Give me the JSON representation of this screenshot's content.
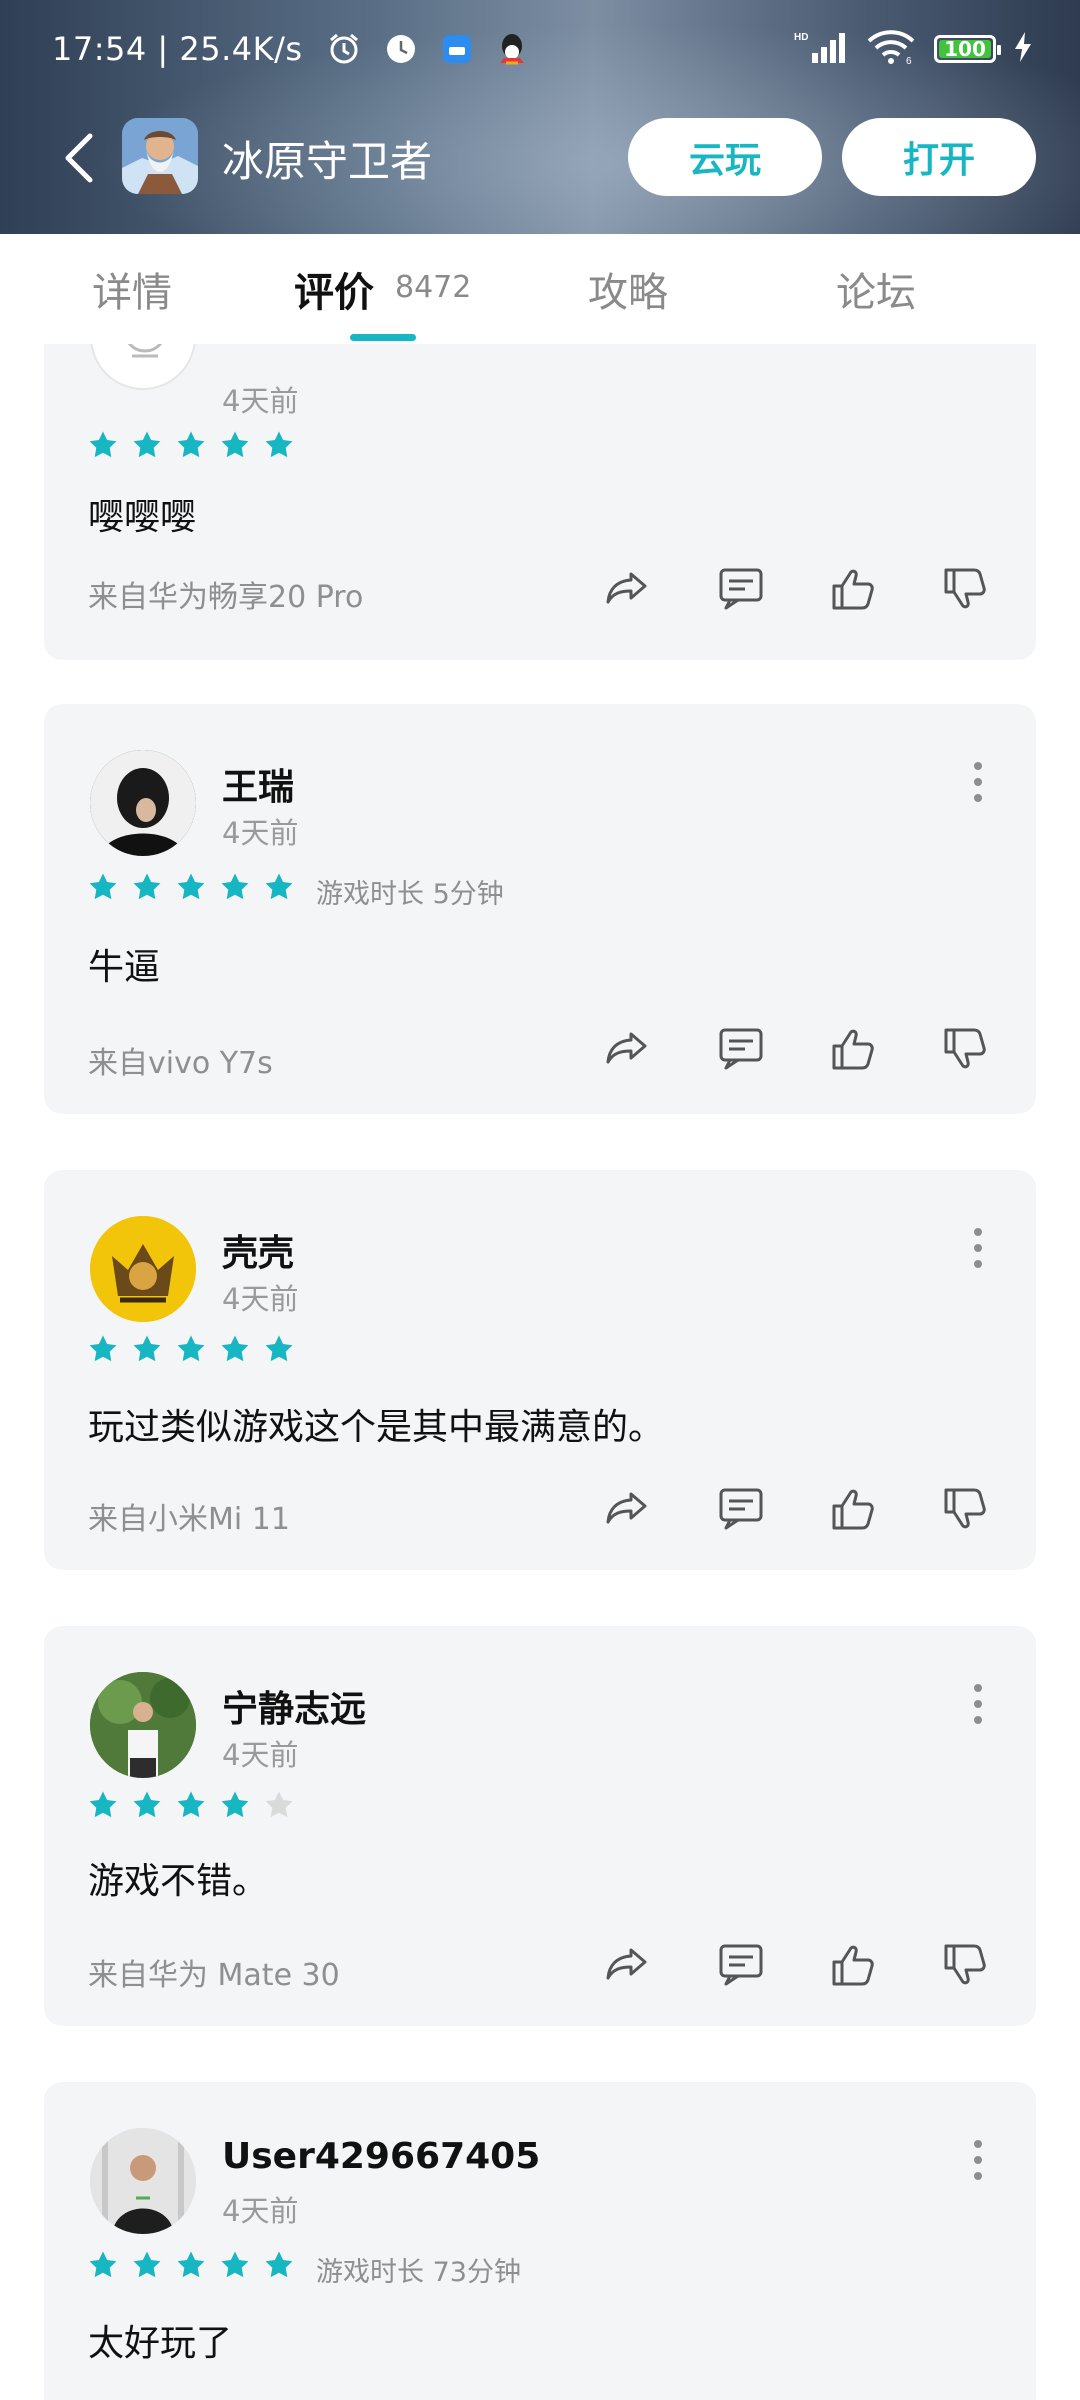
{
  "status_bar": {
    "time_speed": "17:54 | 25.4K/s",
    "battery": "100",
    "signal_label": "HD"
  },
  "header": {
    "title": "冰原守卫者",
    "cloud_play_label": "云玩",
    "open_label": "打开"
  },
  "tabs": [
    {
      "label": "详情"
    },
    {
      "label": "评价",
      "count": "8472"
    },
    {
      "label": "攻略"
    },
    {
      "label": "论坛"
    }
  ],
  "accent_color": "#16b6c2",
  "reviews": [
    {
      "user": "",
      "time": "4天前",
      "stars": 5,
      "playtime": "",
      "text": "嘤嘤嘤",
      "device": "来自华为畅享20 Pro"
    },
    {
      "user": "王瑞",
      "time": "4天前",
      "stars": 5,
      "playtime": "游戏时长 5分钟",
      "text": "牛逼",
      "device": "来自vivo Y7s"
    },
    {
      "user": "壳壳",
      "time": "4天前",
      "stars": 5,
      "playtime": "",
      "text": "玩过类似游戏这个是其中最满意的。",
      "device": "来自小米Mi 11"
    },
    {
      "user": "宁静志远",
      "time": "4天前",
      "stars": 4,
      "playtime": "",
      "text": "游戏不错。",
      "device": "来自华为 Mate 30"
    },
    {
      "user": "User429667405",
      "time": "4天前",
      "stars": 5,
      "playtime": "游戏时长 73分钟",
      "text": "太好玩了",
      "device": ""
    }
  ]
}
